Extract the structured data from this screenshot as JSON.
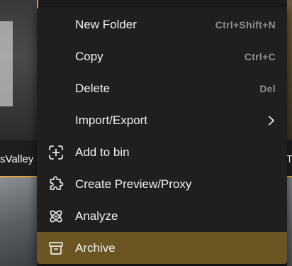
{
  "background": {
    "left_label": "sValley",
    "right_label": "T"
  },
  "menu": {
    "items": [
      {
        "label": "New Folder",
        "shortcut": "Ctrl+Shift+N",
        "icon": ""
      },
      {
        "label": "Copy",
        "shortcut": "Ctrl+C",
        "icon": ""
      },
      {
        "label": "Delete",
        "shortcut": "Del",
        "icon": ""
      },
      {
        "label": "Import/Export",
        "shortcut": "",
        "icon": "chevron-right-icon"
      },
      {
        "label": "Add to bin",
        "shortcut": "",
        "icon": "add-box-icon"
      },
      {
        "label": "Create Preview/Proxy",
        "shortcut": "",
        "icon": "puzzle-icon"
      },
      {
        "label": "Analyze",
        "shortcut": "",
        "icon": "atom-icon"
      },
      {
        "label": "Archive",
        "shortcut": "",
        "icon": "archive-icon",
        "active": true
      }
    ]
  },
  "colors": {
    "menu_bg": "#1f1f1f",
    "active_bg": "#6b5522",
    "accent": "#d9a441",
    "text": "#f2f2f2",
    "shortcut_text": "#8f8f8f"
  }
}
